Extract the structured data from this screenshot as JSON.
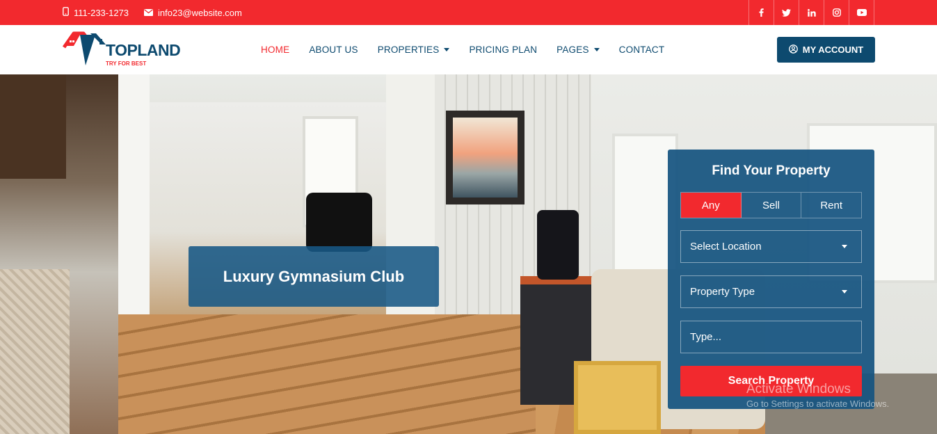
{
  "topbar": {
    "phone": "111-233-1273",
    "email": "info23@website.com",
    "socials": [
      "f",
      "t",
      "in",
      "ig",
      "yt"
    ]
  },
  "header": {
    "logo_text": "TOPLAND",
    "logo_tagline": "TRY FOR BEST",
    "nav": [
      {
        "label": "HOME",
        "active": true
      },
      {
        "label": "ABOUT US"
      },
      {
        "label": "PROPERTIES",
        "dropdown": true
      },
      {
        "label": "PRICING PLAN"
      },
      {
        "label": "PAGES",
        "dropdown": true
      },
      {
        "label": "CONTACT"
      }
    ],
    "account_label": "MY ACCOUNT"
  },
  "hero": {
    "caption": "Luxury Gymnasium Club"
  },
  "search_panel": {
    "title": "Find Your Property",
    "tabs": [
      "Any",
      "Sell",
      "Rent"
    ],
    "active_tab": "Any",
    "location_select": "Select Location",
    "type_select": "Property Type",
    "type_placeholder": "Type...",
    "button_label": "Search Property"
  },
  "watermark": {
    "line1": "Activate Windows",
    "line2": "Go to Settings to activate Windows."
  },
  "colors": {
    "accent": "#f2292e",
    "brand": "#0d4a6f",
    "panel": "#165480"
  }
}
